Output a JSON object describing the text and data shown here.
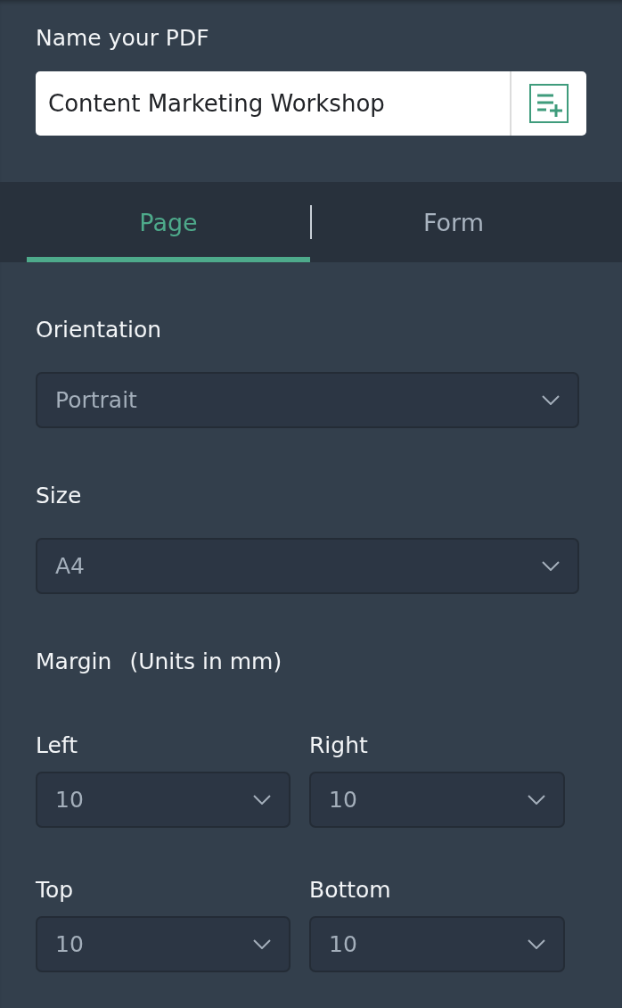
{
  "name_field": {
    "label": "Name your PDF",
    "value": "Content Marketing Workshop"
  },
  "tabs": [
    {
      "label": "Page",
      "selected": true
    },
    {
      "label": "Form",
      "selected": false
    }
  ],
  "orientation": {
    "label": "Orientation",
    "value": "Portrait"
  },
  "size": {
    "label": "Size",
    "value": "A4"
  },
  "margin": {
    "title": "Margin",
    "note": "(Units in mm)",
    "fields": [
      {
        "label": "Left",
        "value": "10"
      },
      {
        "label": "Right",
        "value": "10"
      },
      {
        "label": "Top",
        "value": "10"
      },
      {
        "label": "Bottom",
        "value": "10"
      }
    ]
  }
}
